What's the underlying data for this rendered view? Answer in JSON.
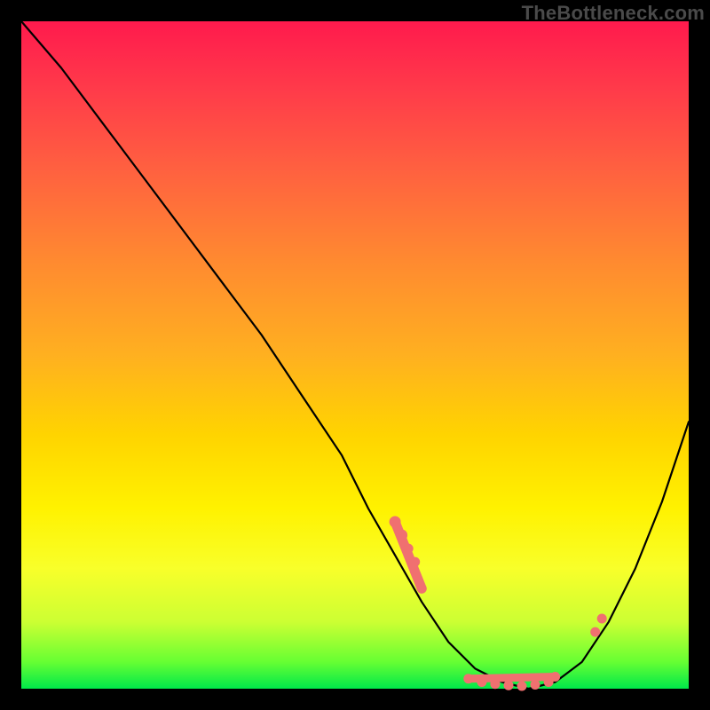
{
  "attribution": "TheBottleneck.com",
  "chart_data": {
    "type": "line",
    "title": "",
    "xlabel": "",
    "ylabel": "",
    "xlim": [
      0,
      100
    ],
    "ylim": [
      0,
      100
    ],
    "curve": {
      "x": [
        0,
        6,
        12,
        18,
        24,
        30,
        36,
        42,
        48,
        52,
        56,
        60,
        64,
        68,
        72,
        76,
        80,
        84,
        88,
        92,
        96,
        100
      ],
      "y": [
        100,
        93,
        85,
        77,
        69,
        61,
        53,
        44,
        35,
        27,
        20,
        13,
        7,
        3,
        1,
        0,
        1,
        4,
        10,
        18,
        28,
        40
      ]
    },
    "points": [
      {
        "x": 56,
        "y": 25,
        "size": 6
      },
      {
        "x": 57,
        "y": 23,
        "size": 6
      },
      {
        "x": 58,
        "y": 21,
        "size": 5
      },
      {
        "x": 59,
        "y": 19,
        "size": 5
      },
      {
        "x": 60,
        "y": 15,
        "size": 5
      },
      {
        "x": 67,
        "y": 1.5,
        "size": 5
      },
      {
        "x": 69,
        "y": 1.0,
        "size": 5
      },
      {
        "x": 71,
        "y": 0.7,
        "size": 5
      },
      {
        "x": 73,
        "y": 0.5,
        "size": 5
      },
      {
        "x": 75,
        "y": 0.4,
        "size": 5
      },
      {
        "x": 77,
        "y": 0.6,
        "size": 5
      },
      {
        "x": 79,
        "y": 1.0,
        "size": 5
      },
      {
        "x": 80,
        "y": 1.8,
        "size": 5
      },
      {
        "x": 86,
        "y": 8.5,
        "size": 5
      },
      {
        "x": 87,
        "y": 10.5,
        "size": 5
      }
    ]
  }
}
